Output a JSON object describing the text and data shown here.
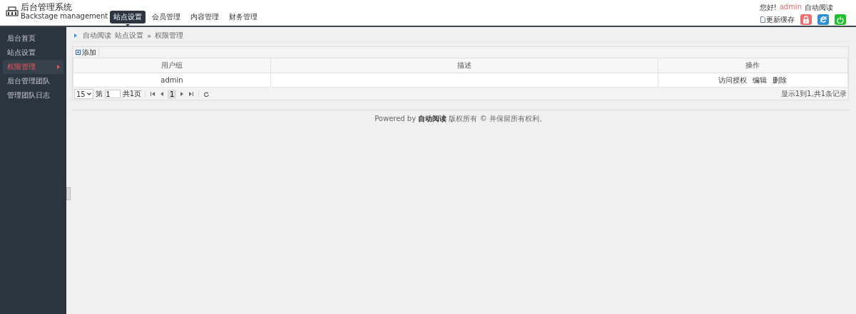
{
  "header": {
    "logo_title": "后台管理系统",
    "logo_subtitle": "Backstage management",
    "nav": [
      {
        "label": "站点设置",
        "selected": true
      },
      {
        "label": "会员管理",
        "selected": false
      },
      {
        "label": "内容管理",
        "selected": false
      },
      {
        "label": "财务管理",
        "selected": false
      }
    ],
    "greeting": "您好!",
    "username": "admin",
    "site_name": "自动阅读",
    "refresh_cache": "更新缓存"
  },
  "sidebar": {
    "items": [
      {
        "label": "后台首页",
        "selected": false
      },
      {
        "label": "站点设置",
        "selected": false
      },
      {
        "label": "权限管理",
        "selected": true
      },
      {
        "label": "后台管理团队",
        "selected": false
      },
      {
        "label": "管理团队日志",
        "selected": false
      }
    ]
  },
  "breadcrumb": {
    "site": "自动阅读",
    "path": [
      "站点设置",
      "权限管理"
    ],
    "separator": "»"
  },
  "toolbar": {
    "add_button": "添加"
  },
  "table": {
    "columns": [
      "用户组",
      "描述",
      "操作"
    ],
    "rows": [
      {
        "user_group": "admin",
        "actions": [
          "访问授权",
          "编辑",
          "删除"
        ]
      }
    ]
  },
  "pager": {
    "page_size": "15",
    "page_prefix": "第",
    "page_value": "1",
    "page_total": "共1页",
    "current_page": "1",
    "summary": "显示1到1,共1条记录"
  },
  "footer": {
    "text": "Powered by **自动阅读** 版权所有 © 并保留所有权利。"
  }
}
